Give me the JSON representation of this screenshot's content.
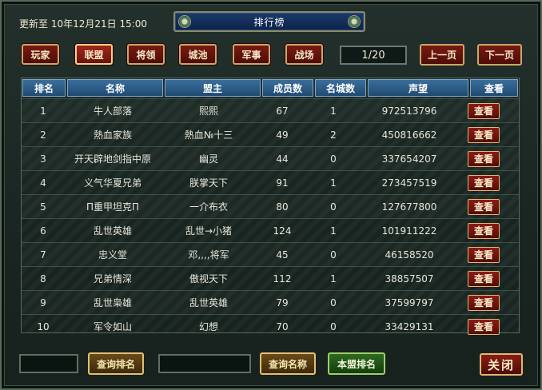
{
  "updated": "更新至 10年12月21日 15:00",
  "title": "排行榜",
  "tabs": [
    {
      "label": "玩家",
      "active": false
    },
    {
      "label": "联盟",
      "active": true
    },
    {
      "label": "将领",
      "active": false
    },
    {
      "label": "城池",
      "active": false
    },
    {
      "label": "军事",
      "active": false
    },
    {
      "label": "战场",
      "active": false
    }
  ],
  "pagination": {
    "indicator": "1/20",
    "prev_label": "上一页",
    "next_label": "下一页"
  },
  "table": {
    "headers": [
      "排名",
      "名称",
      "盟主",
      "成员数",
      "名城数",
      "声望",
      "查看"
    ],
    "rows": [
      {
        "rank": "1",
        "name": "牛人部落",
        "leader": "熙熙",
        "members": "67",
        "cities": "1",
        "prestige": "972513796",
        "view": "查看"
      },
      {
        "rank": "2",
        "name": "熱血家族",
        "leader": "熱血№十三",
        "members": "49",
        "cities": "2",
        "prestige": "450816662",
        "view": "查看"
      },
      {
        "rank": "3",
        "name": "开天辟地剑指中原",
        "leader": "幽灵",
        "members": "44",
        "cities": "0",
        "prestige": "337654207",
        "view": "查看"
      },
      {
        "rank": "4",
        "name": "义气华夏兄弟",
        "leader": "朕掌天下",
        "members": "91",
        "cities": "1",
        "prestige": "273457519",
        "view": "查看"
      },
      {
        "rank": "5",
        "name": "Π重甲坦克Π",
        "leader": "一介布衣",
        "members": "80",
        "cities": "0",
        "prestige": "127677800",
        "view": "查看"
      },
      {
        "rank": "6",
        "name": "乱世英雄",
        "leader": "乱世→小猪",
        "members": "124",
        "cities": "1",
        "prestige": "101911222",
        "view": "查看"
      },
      {
        "rank": "7",
        "name": "忠义堂",
        "leader": "邓,,,,将军",
        "members": "45",
        "cities": "0",
        "prestige": "46158520",
        "view": "查看"
      },
      {
        "rank": "8",
        "name": "兄弟情深",
        "leader": "傲视天下",
        "members": "112",
        "cities": "1",
        "prestige": "38857507",
        "view": "查看"
      },
      {
        "rank": "9",
        "name": "乱世枭雄",
        "leader": "乱世英雄",
        "members": "79",
        "cities": "0",
        "prestige": "37599797",
        "view": "查看"
      },
      {
        "rank": "10",
        "name": "军令如山",
        "leader": "幻想",
        "members": "70",
        "cities": "0",
        "prestige": "33429131",
        "view": "查看"
      }
    ]
  },
  "bottom": {
    "rank_input_value": "",
    "query_rank_label": "查询排名",
    "name_input_value": "",
    "query_name_label": "查询名称",
    "my_alliance_rank_label": "本盟排名",
    "close_label": "关闭"
  }
}
